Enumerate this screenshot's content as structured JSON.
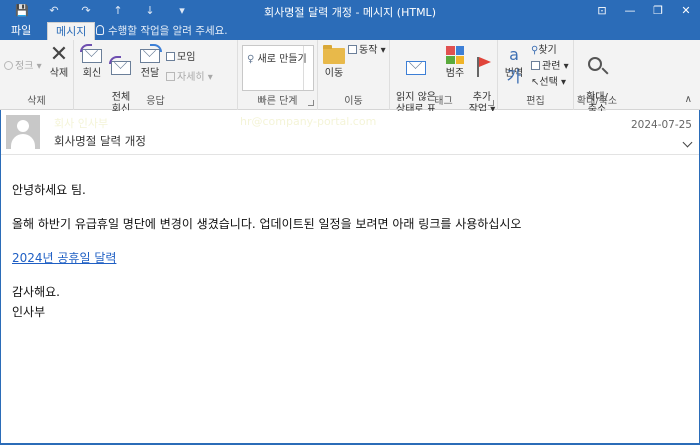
{
  "window": {
    "title": "회사명절 달력 개정 - 메시지 (HTML)",
    "quick_access": [
      "💾",
      "↶",
      "↷",
      "↑",
      "↓",
      "▾"
    ],
    "controls": [
      "⊡",
      "—",
      "❐",
      "✕"
    ]
  },
  "tabs": {
    "file": "파일",
    "message": "메시지",
    "tell_me": "수행할 작업을 알려 주세요."
  },
  "ribbon": {
    "delete": {
      "junk": "정크 ▾",
      "delete": "삭제",
      "label": "삭제"
    },
    "respond": {
      "reply": "회신",
      "reply_all": "전체\n회신",
      "forward": "전달",
      "meeting": "모임",
      "more": "자세히 ▾",
      "label": "응답"
    },
    "quick_steps": {
      "item": "새로 만들기",
      "label": "빠른 단계"
    },
    "move": {
      "move": "이동",
      "actions": "동작 ▾",
      "label": "이동"
    },
    "tags": {
      "unread": "읽지 않은\n상태로 표시",
      "categorize": "범주",
      "follow_up": "추가\n작업 ▾",
      "label": "태그"
    },
    "editing": {
      "translate": "번역",
      "find": "찾기",
      "related": "관련 ▾",
      "select": "선택 ▾",
      "label": "편집"
    },
    "zoom": {
      "zoom": "확대/\n축소",
      "label": "확대/축소"
    }
  },
  "header": {
    "sender_name": "회사 인사부",
    "sender_email": "hr@company-portal.com",
    "subject": "회사명절 달력 개정",
    "date": "2024-07-25"
  },
  "body": {
    "greeting": "안녕하세요 팀.",
    "paragraph": "올해 하반기 유급휴일 명단에 변경이 생겼습니다. 업데이트된 일정을 보려면 아래 링크를 사용하십시오",
    "link_text": "2024년 공휴일 달력",
    "closing": "감사해요.",
    "signature": "인사부"
  },
  "colors": {
    "accent": "#2b6cb8",
    "ribbon_bg": "#f3f3f3",
    "link": "#1f5fc4"
  }
}
